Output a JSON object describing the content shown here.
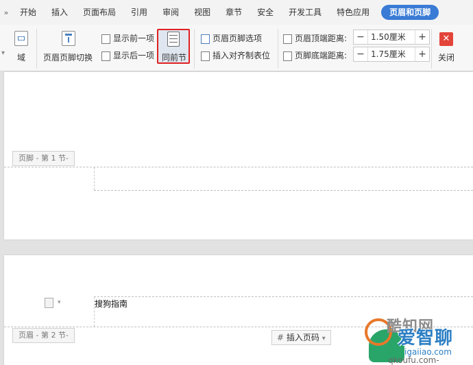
{
  "menu": {
    "chevron": "»",
    "tabs": [
      "开始",
      "插入",
      "页面布局",
      "引用",
      "审阅",
      "视图",
      "章节",
      "安全",
      "开发工具",
      "特色应用"
    ],
    "active_tab": "页眉和页脚"
  },
  "ribbon": {
    "dropdown_caret": "▾",
    "field_label": "域",
    "switch_label": "页眉页脚切换",
    "show_prev": "显示前一项",
    "show_next": "显示后一项",
    "same_as_prev": "同前节",
    "options_label": "页眉页脚选项",
    "insert_tab_label": "插入对齐制表位",
    "header_dist_label": "页眉顶端距离:",
    "header_dist_value": "1.50厘米",
    "footer_dist_label": "页脚底端距离:",
    "footer_dist_value": "1.75厘米",
    "minus": "−",
    "plus": "+",
    "close_label": "关闭",
    "close_glyph": "✕"
  },
  "document": {
    "footer_tag": "页脚 - 第 1 节-",
    "header_tag": "页眉 - 第 2 节-",
    "header_text": "搜狗指南",
    "insert_page_number": "插入页码",
    "insert_page_number_caret": "▾",
    "page_icon_caret": "▾"
  },
  "watermark": {
    "line1": "酷知网",
    "line2": "爱智聊",
    "line3": "igaiiao.com",
    "line4": "qkoufu.com-"
  },
  "colors": {
    "accent": "#3a7bd5",
    "highlight_border": "#e02020",
    "close_red": "#e2443a"
  }
}
